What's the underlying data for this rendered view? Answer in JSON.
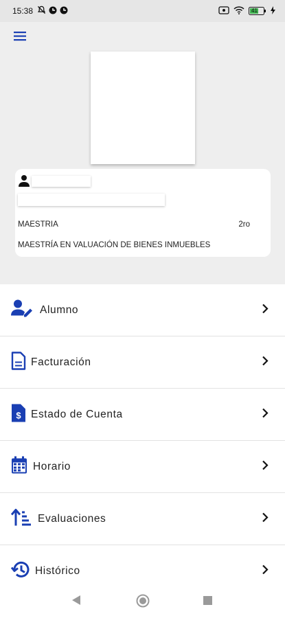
{
  "status_bar": {
    "time": "15:38",
    "battery_level": "41"
  },
  "profile": {
    "program_type": "MAESTRIA",
    "level": "2ro",
    "program_name": "MAESTRÍA EN VALUACIÓN DE BIENES INMUEBLES"
  },
  "menu": {
    "items": [
      {
        "label": "Alumno",
        "icon": "student-edit-icon"
      },
      {
        "label": "Facturación",
        "icon": "document-icon"
      },
      {
        "label": "Estado de Cuenta",
        "icon": "money-document-icon"
      },
      {
        "label": "Horario",
        "icon": "calendar-icon"
      },
      {
        "label": "Evaluaciones",
        "icon": "sort-ascending-icon"
      },
      {
        "label": "Histórico",
        "icon": "history-icon"
      }
    ]
  },
  "colors": {
    "accent": "#1a3fb3",
    "header_bg": "#eeeeee",
    "status_bar_bg": "#e6e6e6"
  }
}
